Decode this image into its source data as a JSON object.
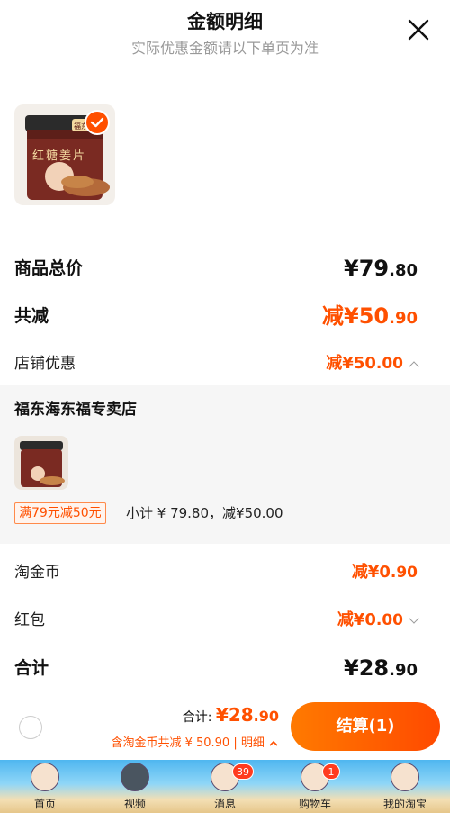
{
  "header": {
    "title": "金额明细",
    "subtitle": "实际优惠金额请以下单页为准"
  },
  "product": {
    "thumb_text": "红糖姜片",
    "thumb_brand": "福东海"
  },
  "summary": {
    "goods_total_label": "商品总价",
    "goods_total_yuan": "¥79",
    "goods_total_fen": ".80",
    "total_reduce_label": "共减",
    "total_reduce_yuan": "减¥50",
    "total_reduce_fen": ".90",
    "shop_discount_label": "店铺优惠",
    "shop_discount_yuan": "减¥50",
    "shop_discount_fen": ".00"
  },
  "shop": {
    "name": "福东海东福专卖店",
    "promo_tag": "满79元减50元",
    "detail": "小计 ¥ 79.80，减¥50.00"
  },
  "discounts": {
    "coin_label": "淘金币",
    "coin_yuan": "减¥0",
    "coin_fen": ".90",
    "redpack_label": "红包",
    "redpack_yuan": "减¥0",
    "redpack_fen": ".00",
    "sum_label": "合计",
    "sum_yuan": "¥28",
    "sum_fen": ".90"
  },
  "footer": {
    "total_label": "合计: ",
    "total_yuan": "¥28",
    "total_fen": ".90",
    "sub_text": "含淘金币共减 ¥ 50.90 | 明细",
    "checkout_label": "结算(1)"
  },
  "tabs": [
    {
      "label": "首页",
      "badge": ""
    },
    {
      "label": "视频",
      "badge": ""
    },
    {
      "label": "消息",
      "badge": "39"
    },
    {
      "label": "购物车",
      "badge": "1"
    },
    {
      "label": "我的淘宝",
      "badge": ""
    }
  ],
  "colors": {
    "accent": "#ff5000",
    "text": "#111111",
    "muted": "#999999",
    "panel": "#f6f6f6"
  },
  "icons": [
    "close-icon",
    "check-icon",
    "chevron-up-icon",
    "chevron-down-icon",
    "radio-icon"
  ]
}
